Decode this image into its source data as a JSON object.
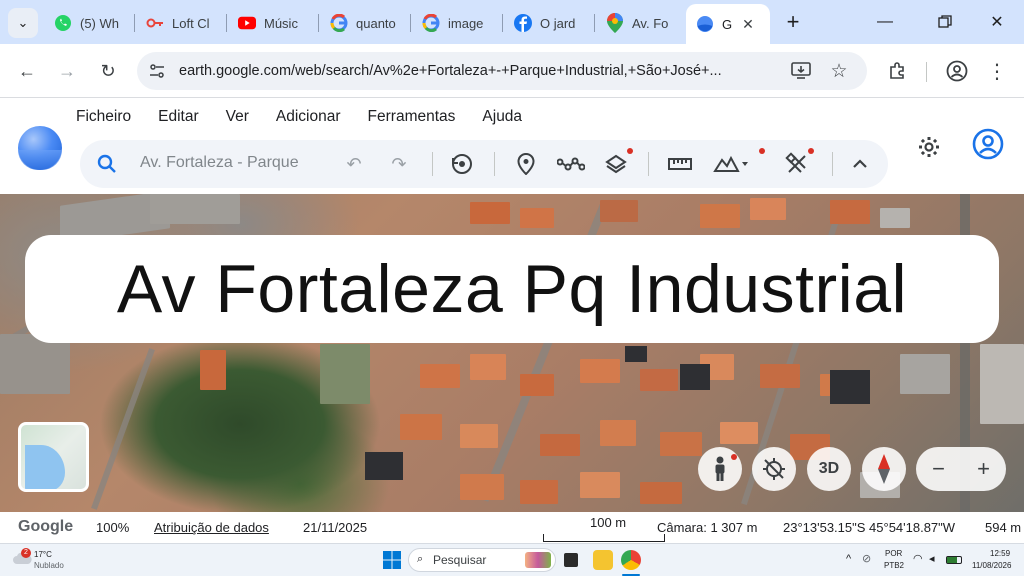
{
  "browser": {
    "tabs": [
      {
        "title": "",
        "icon": "tab-search"
      },
      {
        "title": "(5) Wh",
        "icon": "whatsapp-icon"
      },
      {
        "title": "Loft Cl",
        "icon": "key-icon"
      },
      {
        "title": "Músic",
        "icon": "youtube-icon"
      },
      {
        "title": "quanto",
        "icon": "google-icon"
      },
      {
        "title": "image",
        "icon": "google-icon"
      },
      {
        "title": "O jard",
        "icon": "facebook-icon"
      },
      {
        "title": "Av. Fo",
        "icon": "maps-pin-icon"
      },
      {
        "title": "G",
        "icon": "google-earth-icon",
        "active": true
      }
    ],
    "url": "earth.google.com/web/search/Av%2e+Fortaleza+-+Parque+Industrial,+São+José+...",
    "colors": {
      "tabstrip": "#d3e3fd",
      "active_tab": "#ffffff"
    }
  },
  "earth": {
    "menu": [
      "Ficheiro",
      "Editar",
      "Ver",
      "Adicionar",
      "Ferramentas",
      "Ajuda"
    ],
    "search_value": "Av. Fortaleza - Parque",
    "map_controls": {
      "tilt_label": "3D",
      "zoom_out": "−",
      "zoom_in": "+"
    }
  },
  "overlay": {
    "title": "Av Fortaleza Pq Industrial"
  },
  "status": {
    "brand": "Google",
    "zoom": "100%",
    "attribution": "Atribuição de dados",
    "date": "21/11/2025",
    "scale": "100 m",
    "camera": "Câmara: 1 307 m",
    "coords": "23°13'53.15\"S 45°54'18.87\"W",
    "elevation": "594 m"
  },
  "taskbar": {
    "weather_temp": "17°C",
    "weather_desc": "Nublado",
    "weather_badge": "2",
    "search_placeholder": "Pesquisar",
    "lang_top": "POR",
    "lang_bottom": "PTB2",
    "time": "12:59",
    "date": "11/08/2026"
  }
}
